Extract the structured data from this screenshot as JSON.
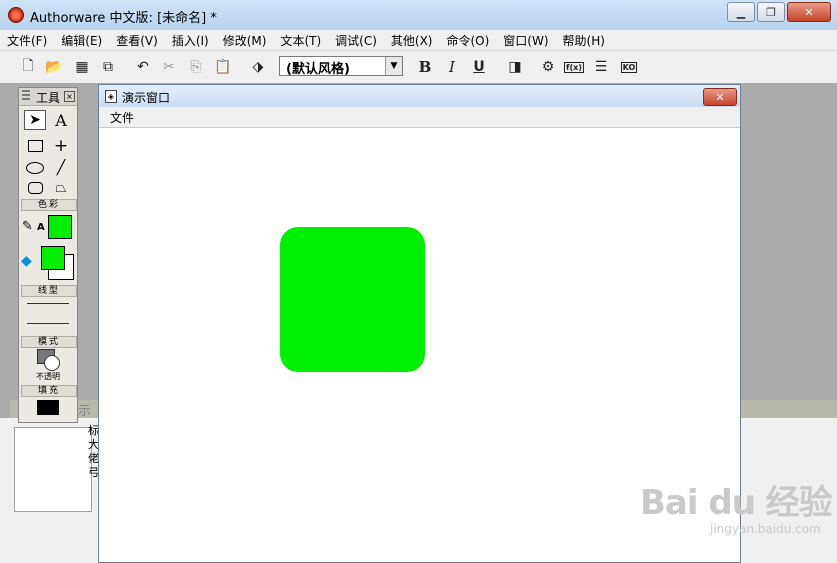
{
  "app": {
    "title": "Authorware 中文版: [未命名] *",
    "window_controls": [
      "minimize",
      "restore",
      "close"
    ]
  },
  "menubar": [
    "文件(F)",
    "编辑(E)",
    "查看(V)",
    "插入(I)",
    "修改(M)",
    "文本(T)",
    "调试(C)",
    "其他(X)",
    "命令(O)",
    "窗口(W)",
    "帮助(H)"
  ],
  "toolbar": {
    "style_value": "(默认风格)",
    "bold": "B",
    "italic": "I",
    "underline": "U",
    "fn_label": "f(x)",
    "ko_label": "KO"
  },
  "tools_palette": {
    "title": "工具",
    "section_color": "色彩",
    "section_line": "线型",
    "section_mode": "模式",
    "mode_value": "不透明",
    "section_fill": "填充",
    "text_tool": "A",
    "color_text_label": "A",
    "colors": {
      "line_text": "#00ee00",
      "fill_fore": "#00ee00",
      "fill_back": "#ffffff",
      "fill_pattern": "#000000"
    }
  },
  "demo_window": {
    "title": "演示窗口",
    "menu": "文件",
    "shape_color": "#00ee00"
  },
  "background_fragments": {
    "strip_text": "示",
    "side_text": [
      "标",
      "大",
      "佬",
      "弓"
    ]
  },
  "watermark": {
    "main": "Bai du 经验",
    "sub": "jingyan.baidu.com"
  }
}
